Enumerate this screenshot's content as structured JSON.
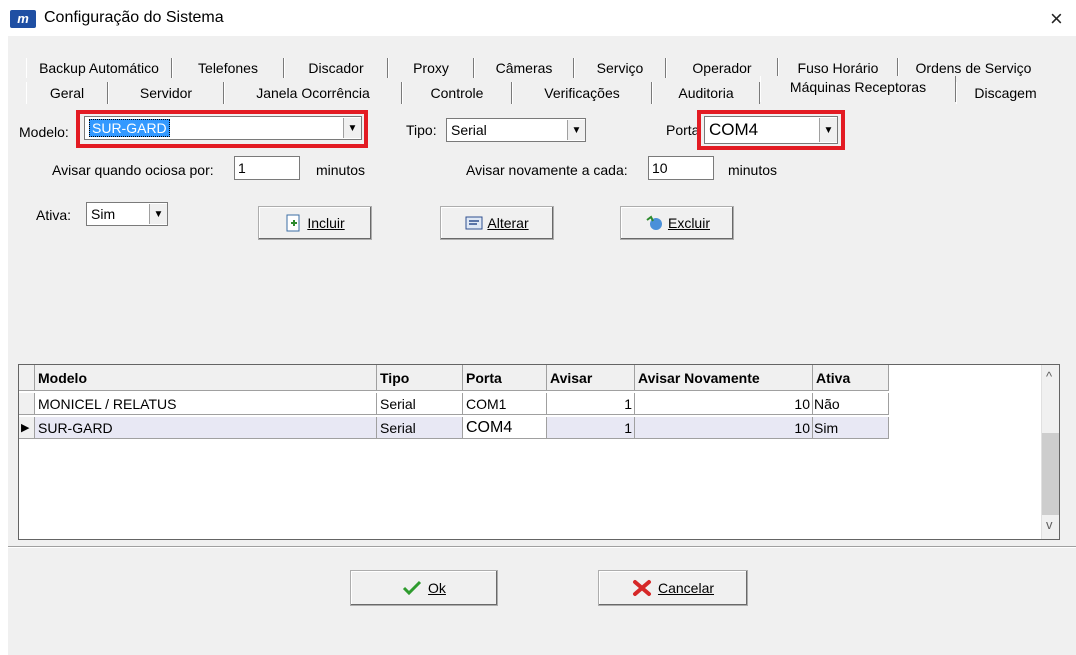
{
  "window": {
    "title": "Configuração do Sistema",
    "app_icon": "m",
    "close": "×"
  },
  "tabs_row1": [
    "Backup Automático",
    "Telefones",
    "Discador",
    "Proxy",
    "Câmeras",
    "Serviço",
    "Operador",
    "Fuso Horário",
    "Ordens de Serviço"
  ],
  "tabs_row2": [
    "Geral",
    "Servidor",
    "Janela Ocorrência",
    "Controle",
    "Verificações",
    "Auditoria",
    "Máquinas Receptoras",
    "Discagem"
  ],
  "form": {
    "modelo_label": "Modelo:",
    "modelo_value": "SUR-GARD",
    "tipo_label": "Tipo:",
    "tipo_value": "Serial",
    "porta_label": "Porta",
    "porta_value": "COM4",
    "avisar_label": "Avisar quando ociosa por:",
    "avisar_value": "1",
    "minutos1": "minutos",
    "avisar_nov_label": "Avisar novamente a cada:",
    "avisar_nov_value": "10",
    "minutos2": "minutos",
    "ativa_label": "Ativa:",
    "ativa_value": "Sim"
  },
  "buttons": {
    "incluir": "Incluir",
    "alterar": "Alterar",
    "excluir": "Excluir",
    "ok": "Ok",
    "cancelar": "Cancelar"
  },
  "table": {
    "headers": [
      "Modelo",
      "Tipo",
      "Porta",
      "Avisar",
      "Avisar Novamente",
      "Ativa"
    ],
    "rows": [
      {
        "modelo": "MONICEL / RELATUS",
        "tipo": "Serial",
        "porta": "COM1",
        "avisar": "1",
        "avisar_nov": "10",
        "ativa": "Não",
        "selected": false
      },
      {
        "modelo": "SUR-GARD",
        "tipo": "Serial",
        "porta": "COM4",
        "avisar": "1",
        "avisar_nov": "10",
        "ativa": "Sim",
        "selected": true
      }
    ]
  },
  "colors": {
    "highlight": "#e31b23",
    "selection": "#3399ff",
    "selected_row": "#e8e8f4"
  },
  "icons": {
    "dropdown": "▼",
    "row_pointer": "▶",
    "scroll_up": "^",
    "scroll_down": "v"
  }
}
